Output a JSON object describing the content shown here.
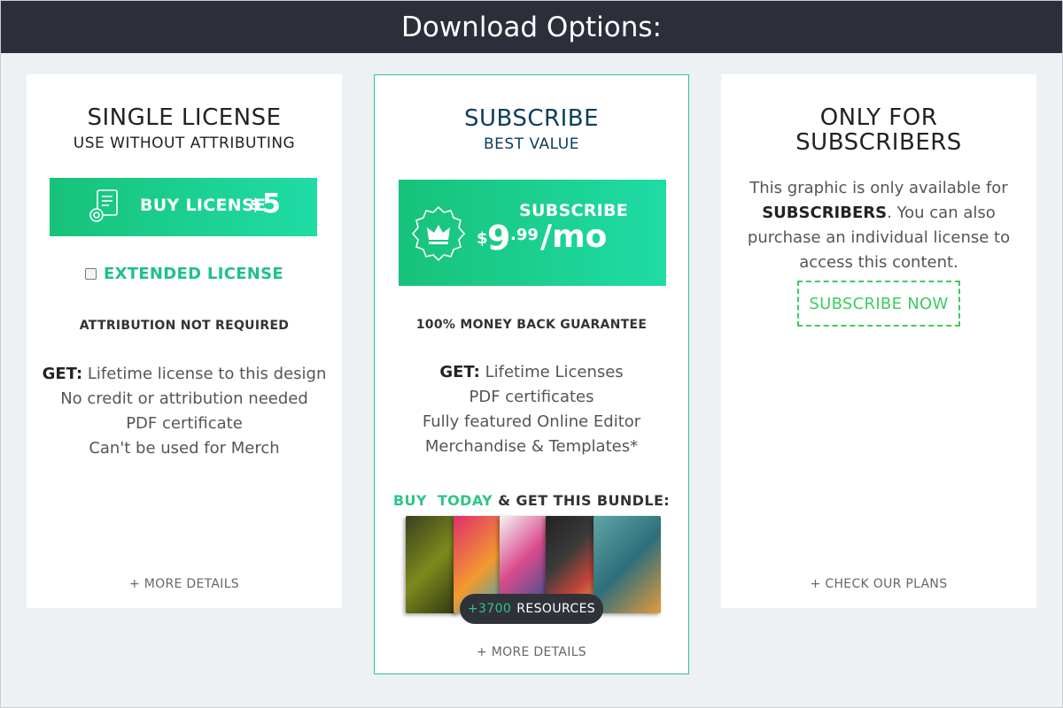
{
  "header": {
    "title": "Download Options:"
  },
  "left": {
    "title": "SINGLE LICENSE",
    "subtitle": "USE WITHOUT ATTRIBUTING",
    "button": {
      "label": "BUY LICENSE",
      "currency": "$",
      "price": "5"
    },
    "extended_label": "EXTENDED LICENSE",
    "note": "ATTRIBUTION NOT REQUIRED",
    "get_label": "GET:",
    "lines": [
      "Lifetime license to this design",
      "No credit or attribution needed",
      "PDF certificate",
      "Can't be used for Merch"
    ],
    "more": "+ MORE DETAILS"
  },
  "mid": {
    "title": "SUBSCRIBE",
    "subtitle": "BEST VALUE",
    "button": {
      "label": "SUBSCRIBE",
      "currency": "$",
      "price_main": "9",
      "price_cents": ".99",
      "period": "/mo"
    },
    "note": "100% MONEY BACK GUARANTEE",
    "get_label": "GET:",
    "lines": [
      "Lifetime Licenses",
      "PDF certificates",
      "Fully featured Online Editor",
      "Merchandise & Templates*"
    ],
    "bundle": {
      "buy": "BUY",
      "today": "TODAY",
      "rest": "& GET THIS BUNDLE:"
    },
    "resources": {
      "count": "+3700",
      "label": "RESOURCES"
    },
    "more": "+ MORE DETAILS"
  },
  "right": {
    "title_line1": "ONLY FOR",
    "title_line2": "SUBSCRIBERS",
    "text_1": "This graphic is only available for",
    "text_bold": "SUBSCRIBERS",
    "text_2": ". You can also",
    "text_3": "purchase an individual license to",
    "text_4": "access this content.",
    "cta": "SUBSCRIBE NOW",
    "more": "+ CHECK OUR PLANS"
  },
  "colors": {
    "accent": "#2fc488",
    "header_bg": "#2c2f39",
    "navy": "#0b3c5d"
  }
}
